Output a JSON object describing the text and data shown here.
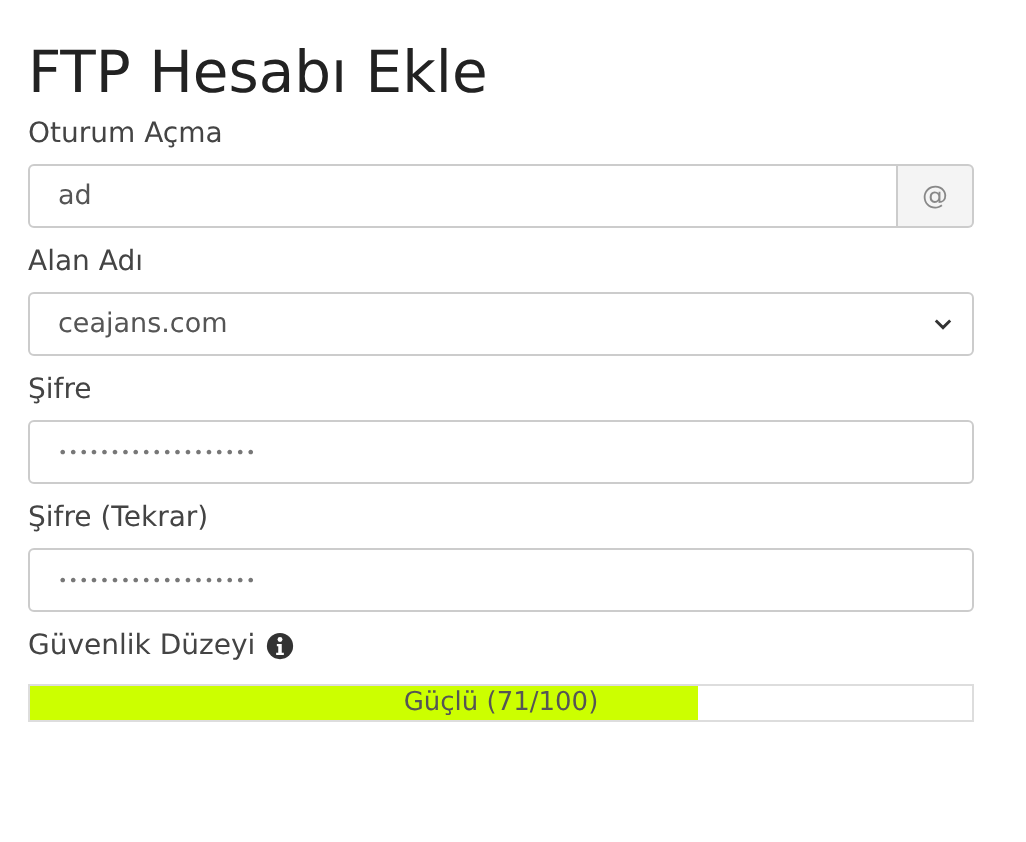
{
  "title": "FTP Hesabı Ekle",
  "fields": [
    {
      "kind": "addon",
      "label": "Oturum Açma",
      "value": "ad",
      "addon": "@"
    },
    {
      "kind": "select",
      "label": "Alan Adı",
      "value": "ceajans.com"
    },
    {
      "kind": "password",
      "label": "Şifre",
      "value": "•••••••••••••••••••"
    },
    {
      "kind": "password",
      "label": "Şifre (Tekrar)",
      "value": "•••••••••••••••••••"
    }
  ],
  "strength": {
    "label": "Güvenlik Düzeyi",
    "level": 0.71,
    "reading": "Güçlü (71/100)"
  }
}
